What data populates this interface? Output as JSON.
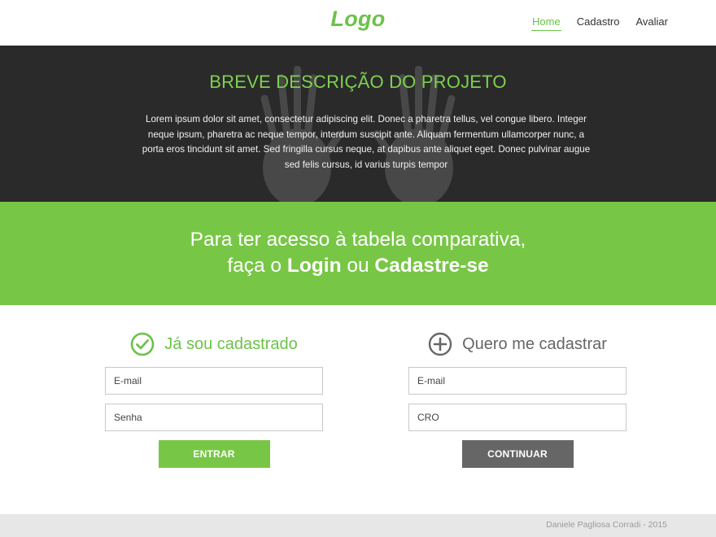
{
  "header": {
    "logo": "Logo",
    "nav": [
      {
        "label": "Home",
        "active": true
      },
      {
        "label": "Cadastro",
        "active": false
      },
      {
        "label": "Avaliar",
        "active": false
      }
    ]
  },
  "hero": {
    "title": "BREVE DESCRIÇÃO DO PROJETO",
    "text": "Lorem ipsum dolor sit amet, consectetur adipiscing elit. Donec a pharetra tellus, vel congue libero. Integer neque ipsum, pharetra ac neque tempor, interdum suscipit ante. Aliquam fermentum ullamcorper nunc, a porta eros tincidunt sit amet. Sed fringilla cursus neque, at dapibus ante aliquet eget. Donec pulvinar augue sed felis cursus, id varius turpis tempor",
    "background_image": "hands-xray"
  },
  "banner": {
    "line1": "Para ter acesso à tabela comparativa,",
    "line2_pre": "faça o ",
    "line2_login": "Login",
    "line2_mid": " ou ",
    "line2_signup": "Cadastre-se"
  },
  "login": {
    "icon": "check-circle-icon",
    "title": "Já sou cadastrado",
    "email_placeholder": "E-mail",
    "password_placeholder": "Senha",
    "button": "ENTRAR"
  },
  "register": {
    "icon": "plus-circle-icon",
    "title": "Quero me cadastrar",
    "email_placeholder": "E-mail",
    "cro_placeholder": "CRO",
    "button": "CONTINUAR"
  },
  "footer": {
    "text": "Daniele Pagliosa Corradi - 2015"
  },
  "colors": {
    "accent": "#78c646",
    "hero_bg": "#2a2a2a",
    "button_gray": "#666666",
    "footer_bg": "#e7e7e7"
  }
}
